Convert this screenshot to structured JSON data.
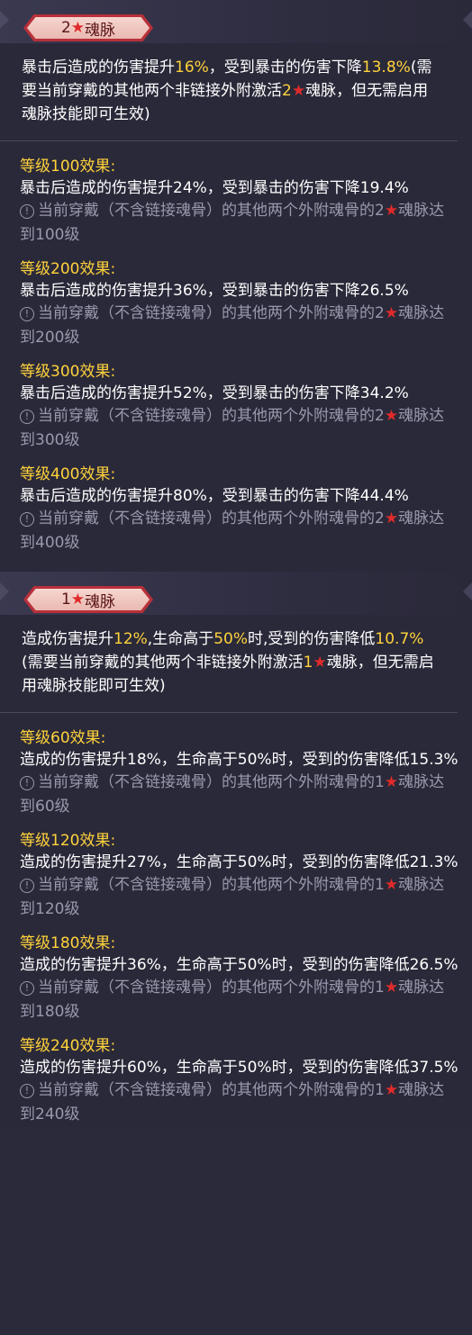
{
  "sections": [
    {
      "badge": {
        "num": "2",
        "label": "魂脉"
      },
      "summary": {
        "t1": "暴击后造成的伤害提升",
        "v1": "16%",
        "t2": "，受到暴击的伤害下降",
        "v2": "13.8%",
        "t3": "(需要当前穿戴的其他两个非链接外附激活",
        "v3": "2",
        "t4": "魂脉，但无需启用魂脉技能即可生效)"
      },
      "levels": [
        {
          "title": "等级100效果:",
          "body": "暴击后造成的伤害提升24%，受到暴击的伤害下降19.4%",
          "cond_a": "当前穿戴（不含链接魂骨）的其他两个外附魂骨的2",
          "cond_b": "魂脉达到100级"
        },
        {
          "title": "等级200效果:",
          "body": "暴击后造成的伤害提升36%，受到暴击的伤害下降26.5%",
          "cond_a": "当前穿戴（不含链接魂骨）的其他两个外附魂骨的2",
          "cond_b": "魂脉达到200级"
        },
        {
          "title": "等级300效果:",
          "body": "暴击后造成的伤害提升52%，受到暴击的伤害下降34.2%",
          "cond_a": "当前穿戴（不含链接魂骨）的其他两个外附魂骨的2",
          "cond_b": "魂脉达到300级"
        },
        {
          "title": "等级400效果:",
          "body": "暴击后造成的伤害提升80%，受到暴击的伤害下降44.4%",
          "cond_a": "当前穿戴（不含链接魂骨）的其他两个外附魂骨的2",
          "cond_b": "魂脉达到400级"
        }
      ]
    },
    {
      "badge": {
        "num": "1",
        "label": "魂脉"
      },
      "summary": {
        "t1": "造成伤害提升",
        "v1": "12%",
        "t2": ",生命高于",
        "v2": "50%",
        "t3": "时,受到的伤害降低",
        "v3": "10.7%",
        "t4": "(需要当前穿戴的其他两个非链接外附激活",
        "v4": "1",
        "t5": "魂脉，但无需启用魂脉技能即可生效)"
      },
      "levels": [
        {
          "title": "等级60效果:",
          "body": "造成的伤害提升18%，生命高于50%时，受到的伤害降低15.3%",
          "cond_a": "当前穿戴（不含链接魂骨）的其他两个外附魂骨的1",
          "cond_b": "魂脉达到60级"
        },
        {
          "title": "等级120效果:",
          "body": "造成的伤害提升27%，生命高于50%时，受到的伤害降低21.3%",
          "cond_a": "当前穿戴（不含链接魂骨）的其他两个外附魂骨的1",
          "cond_b": "魂脉达到120级"
        },
        {
          "title": "等级180效果:",
          "body": "造成的伤害提升36%，生命高于50%时，受到的伤害降低26.5%",
          "cond_a": "当前穿戴（不含链接魂骨）的其他两个外附魂骨的1",
          "cond_b": "魂脉达到180级"
        },
        {
          "title": "等级240效果:",
          "body": "造成的伤害提升60%，生命高于50%时，受到的伤害降低37.5%",
          "cond_a": "当前穿戴（不含链接魂骨）的其他两个外附魂骨的1",
          "cond_b": "魂脉达到240级"
        }
      ]
    }
  ],
  "icons": {
    "star": "★",
    "warning": "!"
  },
  "colors": {
    "highlight": "#ffd23c",
    "star": "#e02a2a",
    "badge_border": "#b8303a",
    "muted": "#9a98ad",
    "background": "#2a2939"
  }
}
